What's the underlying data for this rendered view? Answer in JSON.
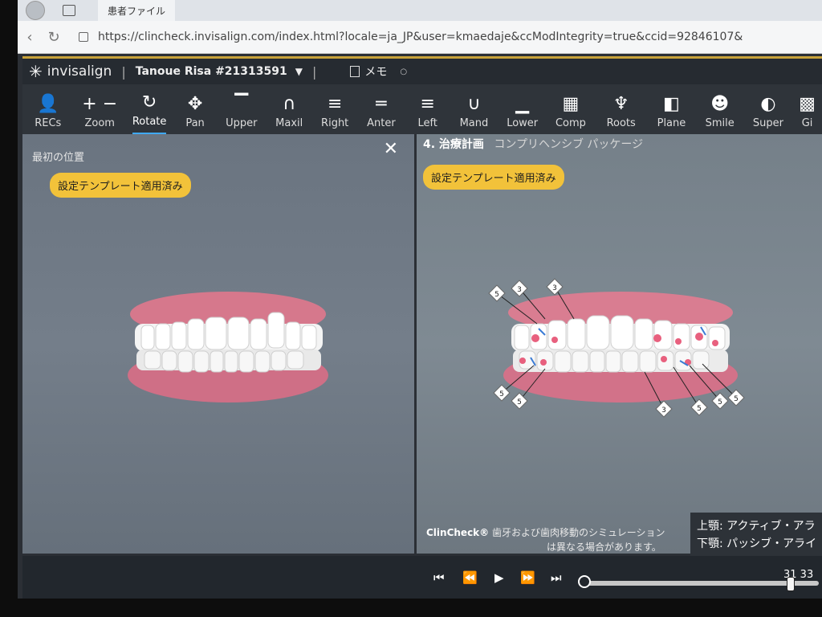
{
  "browser": {
    "tab_title": "患者ファイル",
    "url": "https://clincheck.invisalign.com/index.html?locale=ja_JP&user=kmaedaje&ccModIntegrity=true&ccid=92846107&"
  },
  "header": {
    "brand": "invisalign",
    "patient": "Tanoue Risa #21313591",
    "memo": "メモ"
  },
  "toolbar": {
    "items": [
      {
        "label": "RECs",
        "icon": "person-icon",
        "glyph": "👤"
      },
      {
        "label": "Zoom",
        "icon": "zoom-icon",
        "glyph": "+ −"
      },
      {
        "label": "Rotate",
        "icon": "rotate-icon",
        "glyph": "↻"
      },
      {
        "label": "Pan",
        "icon": "pan-icon",
        "glyph": "✥"
      },
      {
        "label": "Upper",
        "icon": "upper-icon",
        "glyph": "▔"
      },
      {
        "label": "Maxil",
        "icon": "maxil-icon",
        "glyph": "∩"
      },
      {
        "label": "Right",
        "icon": "right-icon",
        "glyph": "≡"
      },
      {
        "label": "Anter",
        "icon": "anter-icon",
        "glyph": "═"
      },
      {
        "label": "Left",
        "icon": "left-icon",
        "glyph": "≡"
      },
      {
        "label": "Mand",
        "icon": "mand-icon",
        "glyph": "∪"
      },
      {
        "label": "Lower",
        "icon": "lower-icon",
        "glyph": "▁"
      },
      {
        "label": "Comp",
        "icon": "comp-icon",
        "glyph": "▦"
      },
      {
        "label": "Roots",
        "icon": "roots-icon",
        "glyph": "♆"
      },
      {
        "label": "Plane",
        "icon": "plane-icon",
        "glyph": "◧"
      },
      {
        "label": "Smile",
        "icon": "smile-icon",
        "glyph": "☻"
      },
      {
        "label": "Super",
        "icon": "super-icon",
        "glyph": "◐"
      },
      {
        "label": "Gi",
        "icon": "grid-icon",
        "glyph": "▩"
      }
    ],
    "active": "Rotate"
  },
  "left_view": {
    "title": "最初の位置",
    "badge": "設定テンプレート適用済み"
  },
  "right_view": {
    "step": "4. 治療計画",
    "subtitle": "コンプリヘンシブ パッケージ",
    "badge": "設定テンプレート適用済み",
    "disclaimer_brand": "ClinCheck®",
    "disclaimer_line1": "歯牙および歯肉移動のシミュレーション",
    "disclaimer_line2": "は異なる場合があります。",
    "markers": [
      "5",
      "3",
      "3",
      "5",
      "5",
      "3",
      "5",
      "5",
      "5"
    ]
  },
  "legend": {
    "upper": "上顎: アクティブ・アラ",
    "lower": "下顎: パッシブ・アライ"
  },
  "player": {
    "frame": "31 33",
    "progress": 0.93
  },
  "colors": {
    "accent_bar": "#c8a23a",
    "badge": "#f2c23a",
    "active_tab": "#3fa9f5"
  }
}
